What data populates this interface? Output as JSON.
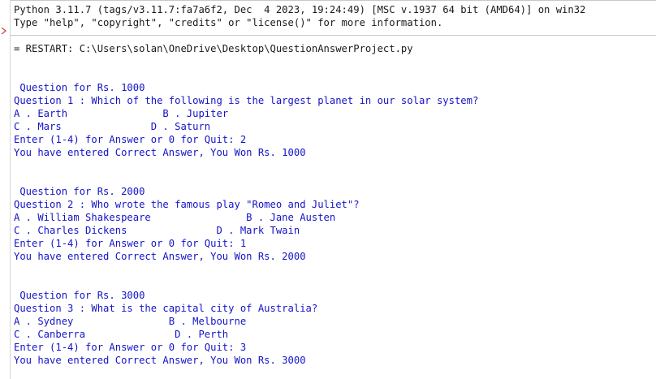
{
  "shell": {
    "banner_line1": "Python 3.11.7 (tags/v3.11.7:fa7a6f2, Dec  4 2023, 19:24:49) [MSC v.1937 64 bit (AMD64)] on win32",
    "banner_line2": "Type \"help\", \"copyright\", \"credits\" or \"license()\" for more information.",
    "restart_line": "= RESTART: C:\\Users\\solan\\OneDrive\\Desktop\\QuestionAnswerProject.py",
    "prompt_marker_icon": "prompt-arrow-icon",
    "colors": {
      "stdout": "#1a1a1a",
      "quiz": "#1414c8",
      "marker": "#d14a4a"
    }
  },
  "output": {
    "q1": {
      "heading": " Question for Rs. 1000",
      "question": "Question 1 : Which of the following is the largest planet in our solar system?",
      "options_row1": "A . Earth                B . Jupiter",
      "options_row2": "C . Mars               D . Saturn",
      "input_prompt": "Enter (1-4) for Answer or 0 for Quit: 2",
      "result": "You have entered Correct Answer, You Won Rs. 1000"
    },
    "q2": {
      "heading": " Question for Rs. 2000",
      "question": "Question 2 : Who wrote the famous play \"Romeo and Juliet\"?",
      "options_row1": "A . William Shakespeare                B . Jane Austen",
      "options_row2": "C . Charles Dickens               D . Mark Twain",
      "input_prompt": "Enter (1-4) for Answer or 0 for Quit: 1",
      "result": "You have entered Correct Answer, You Won Rs. 2000"
    },
    "q3": {
      "heading": " Question for Rs. 3000",
      "question": "Question 3 : What is the capital city of Australia?",
      "options_row1": "A . Sydney                B . Melbourne",
      "options_row2": "C . Canberra               D . Perth",
      "input_prompt": "Enter (1-4) for Answer or 0 for Quit: 3",
      "result": "You have entered Correct Answer, You Won Rs. 3000"
    }
  }
}
